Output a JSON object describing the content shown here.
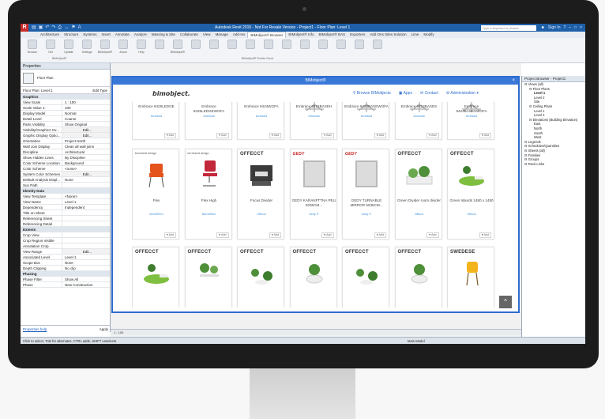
{
  "window": {
    "app_badge": "R",
    "title": "Autodesk Revit 2015 - Not For Resale Version -  Project1 - Floor Plan: Level 1",
    "search_placeholder": "Type a keyword or phrase",
    "sign_in": "Sign In",
    "qat_icons": [
      "open-icon",
      "save-icon",
      "undo-icon",
      "redo-icon",
      "print-icon",
      "measure-icon",
      "tag-icon",
      "text-icon"
    ]
  },
  "ribbon": {
    "tabs": [
      "Architecture",
      "Structure",
      "Systems",
      "Insert",
      "Annotate",
      "Analyze",
      "Massing & Site",
      "Collaborate",
      "View",
      "Manage",
      "Add-Ins",
      "BIMobject® Browser",
      "BIMobject® Info",
      "BIMobject® BAS",
      "Exporters",
      "Add Ons Sites Solution",
      "Lime",
      "Modify"
    ],
    "active_tab": "BIMobject® Browser",
    "buttons": [
      "Browse",
      "Get",
      "Update",
      "Settings",
      "BIMobject®",
      "About",
      "Help",
      "",
      "BIMobject®",
      "",
      "",
      "",
      "",
      "",
      "",
      "",
      "",
      "",
      "",
      ""
    ],
    "group_left": "BIMobject®",
    "group_right": "BIMobject® Private Cloud"
  },
  "properties": {
    "header": "Properties",
    "type_name": "Floor Plan",
    "selector": "Floor Plan: Level 1",
    "edit_type": "Edit Type",
    "rows": [
      {
        "k": "Graphics",
        "v": "",
        "cat": true
      },
      {
        "k": "View Scale",
        "v": "1 : 100"
      },
      {
        "k": "Scale Value    1:",
        "v": "100"
      },
      {
        "k": "Display Model",
        "v": "Normal"
      },
      {
        "k": "Detail Level",
        "v": "Coarse"
      },
      {
        "k": "Parts Visibility",
        "v": "Show Original"
      },
      {
        "k": "Visibility/Graphics Ov...",
        "v": "Edit...",
        "btn": true
      },
      {
        "k": "Graphic Display Optio...",
        "v": "Edit...",
        "btn": true
      },
      {
        "k": "Orientation",
        "v": "Project North"
      },
      {
        "k": "Wall Join Display",
        "v": "Clean all wall joins"
      },
      {
        "k": "Discipline",
        "v": "Architectural"
      },
      {
        "k": "Show Hidden Lines",
        "v": "By Discipline"
      },
      {
        "k": "Color Scheme Location",
        "v": "Background"
      },
      {
        "k": "Color Scheme",
        "v": "<none>"
      },
      {
        "k": "System Color Schemes",
        "v": "Edit...",
        "btn": true
      },
      {
        "k": "Default Analysis Displ...",
        "v": "None"
      },
      {
        "k": "Sun Path",
        "v": ""
      },
      {
        "k": "Identity Data",
        "v": "",
        "cat": true
      },
      {
        "k": "View Template",
        "v": "<None>"
      },
      {
        "k": "View Name",
        "v": "Level 1"
      },
      {
        "k": "Dependency",
        "v": "Independent"
      },
      {
        "k": "Title on Sheet",
        "v": ""
      },
      {
        "k": "Referencing Sheet",
        "v": ""
      },
      {
        "k": "Referencing Detail",
        "v": ""
      },
      {
        "k": "Extents",
        "v": "",
        "cat": true
      },
      {
        "k": "Crop View",
        "v": ""
      },
      {
        "k": "Crop Region Visible",
        "v": ""
      },
      {
        "k": "Annotation Crop",
        "v": ""
      },
      {
        "k": "View Range",
        "v": "Edit...",
        "btn": true
      },
      {
        "k": "Associated Level",
        "v": "Level 1"
      },
      {
        "k": "Scope Box",
        "v": "None"
      },
      {
        "k": "Depth Clipping",
        "v": "No clip"
      },
      {
        "k": "Phasing",
        "v": "",
        "cat": true
      },
      {
        "k": "Phase Filter",
        "v": "Show All"
      },
      {
        "k": "Phase",
        "v": "New Construction"
      }
    ],
    "help_link": "Properties help",
    "apply": "Apply"
  },
  "browser": {
    "header": "Project Browser - Project1",
    "nodes": [
      {
        "t": "Views (all)",
        "d": 0,
        "b": false
      },
      {
        "t": "Floor Plans",
        "d": 1,
        "b": false
      },
      {
        "t": "Level 1",
        "d": 2,
        "b": true
      },
      {
        "t": "Level 2",
        "d": 2,
        "b": false
      },
      {
        "t": "Site",
        "d": 2,
        "b": false
      },
      {
        "t": "Ceiling Plans",
        "d": 1,
        "b": false
      },
      {
        "t": "Level 1",
        "d": 2,
        "b": false
      },
      {
        "t": "Level 2",
        "d": 2,
        "b": false
      },
      {
        "t": "Elevations (Building Elevation)",
        "d": 1,
        "b": false
      },
      {
        "t": "East",
        "d": 2,
        "b": false
      },
      {
        "t": "North",
        "d": 2,
        "b": false
      },
      {
        "t": "South",
        "d": 2,
        "b": false
      },
      {
        "t": "West",
        "d": 2,
        "b": false
      },
      {
        "t": "Legends",
        "d": 0,
        "b": false
      },
      {
        "t": "Schedules/Quantities",
        "d": 0,
        "b": false
      },
      {
        "t": "Sheets (all)",
        "d": 0,
        "b": false
      },
      {
        "t": "Families",
        "d": 0,
        "b": false
      },
      {
        "t": "Groups",
        "d": 0,
        "b": false
      },
      {
        "t": "Revit Links",
        "d": 0,
        "b": false
      }
    ]
  },
  "plugin": {
    "title": "BIMobject®",
    "logo": "bimobject.",
    "links": [
      "Browse BIMobjects",
      "Apps",
      "Contact",
      "Administration"
    ],
    "to_top": "^"
  },
  "cards": [
    {
      "brand": "",
      "name": "Embrace 9425LEDGE",
      "mfr": "Arnesola",
      "art": "chair-legs"
    },
    {
      "brand": "",
      "name": "Embrace 9425LEDGEWOFA",
      "mfr": "Arnesola",
      "art": "chair-legs"
    },
    {
      "brand": "",
      "name": "Embrace 9424WOFA",
      "mfr": "Arnesola",
      "art": "chair-legs"
    },
    {
      "brand": "",
      "name": "Embrace 9424BASEH",
      "mfr": "Arnesola",
      "art": "chair-base"
    },
    {
      "brand": "",
      "name": "Embrace 9424BASEWOFA",
      "mfr": "Arnesola",
      "art": "chair-base"
    },
    {
      "brand": "",
      "name": "Embrace 9424BASES",
      "mfr": "Arnesola",
      "art": "chair-base"
    },
    {
      "brand": "",
      "name": "Embrace 9424BASESWOFA",
      "mfr": "Arnesola",
      "art": "chair-base"
    },
    {
      "brand": "bernhardt design",
      "name": "Flex",
      "mfr": "BernhRem",
      "art": "orange-chair",
      "small": true
    },
    {
      "brand": "bernhardt design",
      "name": "Flex High",
      "mfr": "BernhRem",
      "art": "red-chair",
      "small": true
    },
    {
      "brand": "OFFECCT",
      "name": "Focus Divider",
      "mfr": "Offecct",
      "art": "divider"
    },
    {
      "brand": "GEDY",
      "name": "GEDY KARANFTTNA PELI 5036CM...",
      "mfr": "Gedy IT",
      "art": "mirror",
      "red": true
    },
    {
      "brand": "GEDY",
      "name": "GEDY TURNABLE MIRROR 5036CM...",
      "mfr": "Gedy IT",
      "art": "mirror",
      "red": true
    },
    {
      "brand": "OFFECCT",
      "name": "Green Divider room divider",
      "mfr": "Offecct",
      "art": "plant-divider"
    },
    {
      "brand": "OFFECCT",
      "name": "Green Islands 1480 x 1480",
      "mfr": "Offecct",
      "art": "green-island"
    },
    {
      "brand": "OFFECCT",
      "name": "",
      "mfr": "",
      "art": "green-island"
    },
    {
      "brand": "OFFECCT",
      "name": "",
      "mfr": "",
      "art": "plant-table"
    },
    {
      "brand": "OFFECCT",
      "name": "",
      "mfr": "",
      "art": "plants"
    },
    {
      "brand": "OFFECCT",
      "name": "",
      "mfr": "",
      "art": "plant-pot"
    },
    {
      "brand": "OFFECCT",
      "name": "",
      "mfr": "",
      "art": "plants"
    },
    {
      "brand": "OFFECCT",
      "name": "",
      "mfr": "",
      "art": "plant-pot"
    },
    {
      "brand": "SWEDESE",
      "name": "",
      "mfr": "",
      "art": "yellow-chair"
    }
  ],
  "add_label": "Add",
  "viewbar": "1 : 100",
  "statusbar": "Click to select, TAB for alternates, CTRL adds, SHIFT unselects.",
  "statusbar_right": "Main Model"
}
